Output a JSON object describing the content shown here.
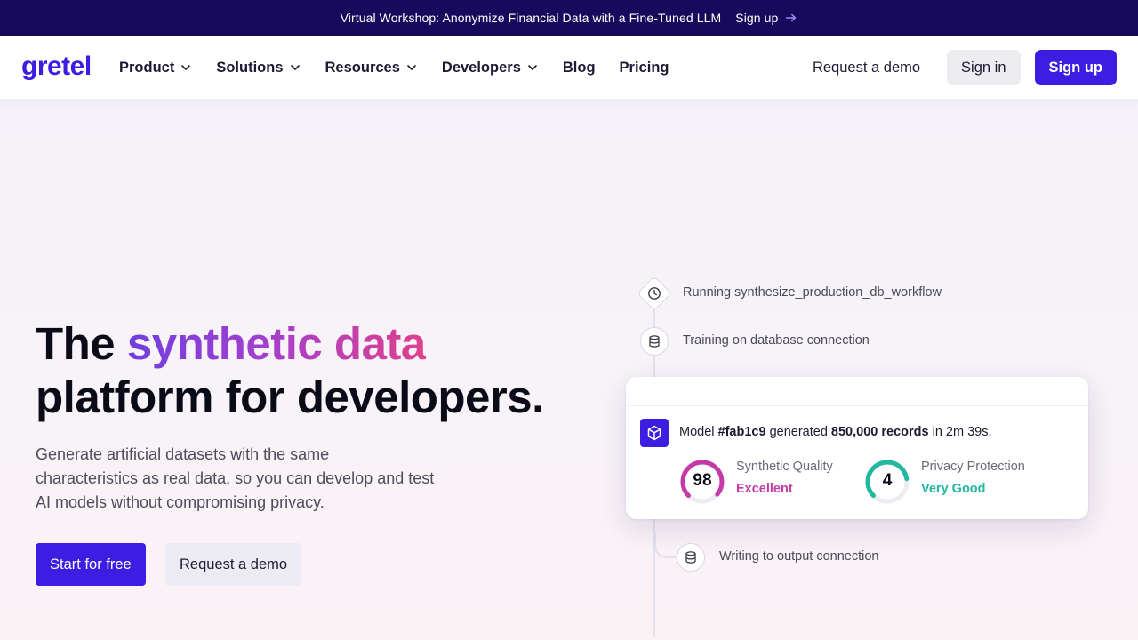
{
  "banner": {
    "message": "Virtual Workshop: Anonymize Financial Data with a Fine-Tuned LLM",
    "cta": "Sign up",
    "cta_icon": "arrow-right-icon"
  },
  "nav": {
    "logo_text": "gretel",
    "menu": [
      {
        "label": "Product",
        "dropdown": true
      },
      {
        "label": "Solutions",
        "dropdown": true
      },
      {
        "label": "Resources",
        "dropdown": true
      },
      {
        "label": "Developers",
        "dropdown": true
      },
      {
        "label": "Blog",
        "dropdown": false
      },
      {
        "label": "Pricing",
        "dropdown": false
      }
    ],
    "request_demo": "Request a demo",
    "sign_in": "Sign in",
    "sign_up": "Sign up"
  },
  "hero": {
    "title_lead": "The",
    "title_highlight": "synthetic data",
    "title_rest": "platform for developers.",
    "subtitle": "Generate artificial datasets with the same characteristics as real data, so you can develop and test AI models without compromising privacy.",
    "primary_cta": "Start for free",
    "secondary_cta": "Request a demo"
  },
  "workflow": {
    "steps": [
      {
        "text": "Running synthesize_production_db_workflow",
        "icon": "clock-icon"
      },
      {
        "text": "Training on database connection",
        "icon": "database-icon"
      },
      {
        "text": "Writing to output connection",
        "icon": "database-icon"
      }
    ],
    "card": {
      "prefix": "Model",
      "model_id": "#fab1c9",
      "middle": "generated",
      "records": "850,000 records",
      "suffix": "in 2m 39s.",
      "metrics": [
        {
          "score": "98",
          "score_fraction": 0.98,
          "label": "Synthetic Quality",
          "value": "Excellent",
          "color": "#c43aa8"
        },
        {
          "score": "4",
          "score_fraction": 0.8,
          "label": "Privacy Protection",
          "value": "Very Good",
          "color": "#22b8a0"
        }
      ]
    }
  },
  "colors": {
    "brand": "#3d1de2",
    "banner_bg": "#170a5c",
    "gradient_start": "#6f3fe0",
    "gradient_end": "#e0408d"
  }
}
